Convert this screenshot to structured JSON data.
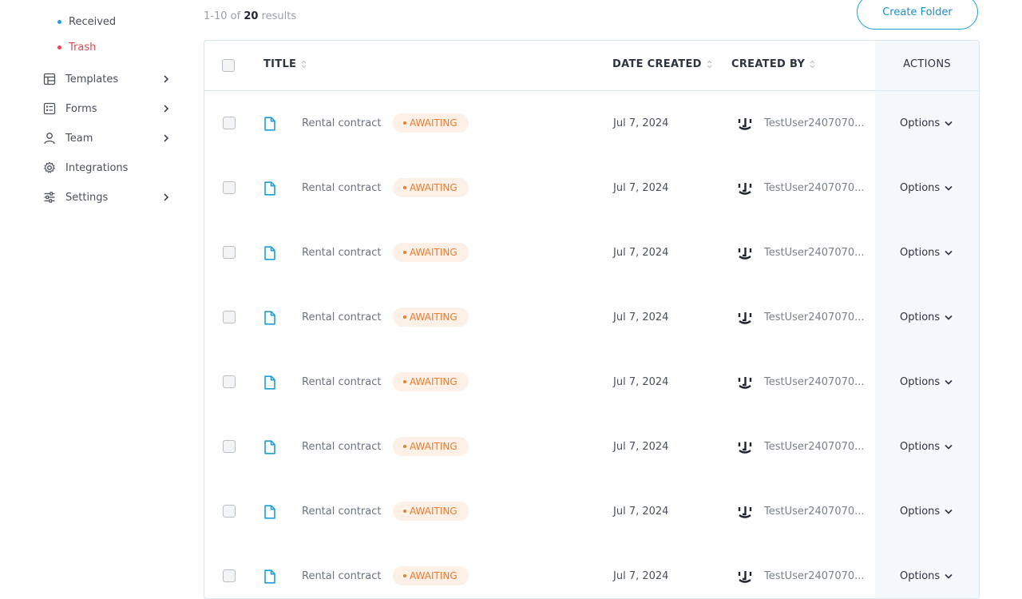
{
  "sidebar": {
    "sub_items": [
      {
        "label": "Received",
        "color": "#1aa0df"
      },
      {
        "label": "Trash",
        "color": "#e5484d"
      }
    ],
    "items": [
      {
        "label": "Templates",
        "icon": "template-icon",
        "has_chevron": true
      },
      {
        "label": "Forms",
        "icon": "form-icon",
        "has_chevron": true
      },
      {
        "label": "Team",
        "icon": "user-icon",
        "has_chevron": true
      },
      {
        "label": "Integrations",
        "icon": "gear-icon",
        "has_chevron": false
      },
      {
        "label": "Settings",
        "icon": "sliders-icon",
        "has_chevron": true
      }
    ]
  },
  "toolbar": {
    "results_prefix": "1-10 of",
    "results_total": "20",
    "results_suffix": "results",
    "create_folder_label": "Create Folder"
  },
  "table": {
    "headers": {
      "title": "TITLE",
      "date_created": "DATE CREATED",
      "created_by": "CREATED BY",
      "actions": "ACTIONS"
    },
    "rows": [
      {
        "title": "Rental contract",
        "status": "AWAITING",
        "date": "Jul 7, 2024",
        "created_by": "TestUser2407070...",
        "action": "Options"
      },
      {
        "title": "Rental contract",
        "status": "AWAITING",
        "date": "Jul 7, 2024",
        "created_by": "TestUser2407070...",
        "action": "Options"
      },
      {
        "title": "Rental contract",
        "status": "AWAITING",
        "date": "Jul 7, 2024",
        "created_by": "TestUser2407070...",
        "action": "Options"
      },
      {
        "title": "Rental contract",
        "status": "AWAITING",
        "date": "Jul 7, 2024",
        "created_by": "TestUser2407070...",
        "action": "Options"
      },
      {
        "title": "Rental contract",
        "status": "AWAITING",
        "date": "Jul 7, 2024",
        "created_by": "TestUser2407070...",
        "action": "Options"
      },
      {
        "title": "Rental contract",
        "status": "AWAITING",
        "date": "Jul 7, 2024",
        "created_by": "TestUser2407070...",
        "action": "Options"
      },
      {
        "title": "Rental contract",
        "status": "AWAITING",
        "date": "Jul 7, 2024",
        "created_by": "TestUser2407070...",
        "action": "Options"
      },
      {
        "title": "Rental contract",
        "status": "AWAITING",
        "date": "Jul 7, 2024",
        "created_by": "TestUser2407070...",
        "action": "Options"
      }
    ]
  },
  "colors": {
    "accent": "#1aa0df",
    "awaiting": "#f07a2a",
    "trash": "#e5484d"
  }
}
